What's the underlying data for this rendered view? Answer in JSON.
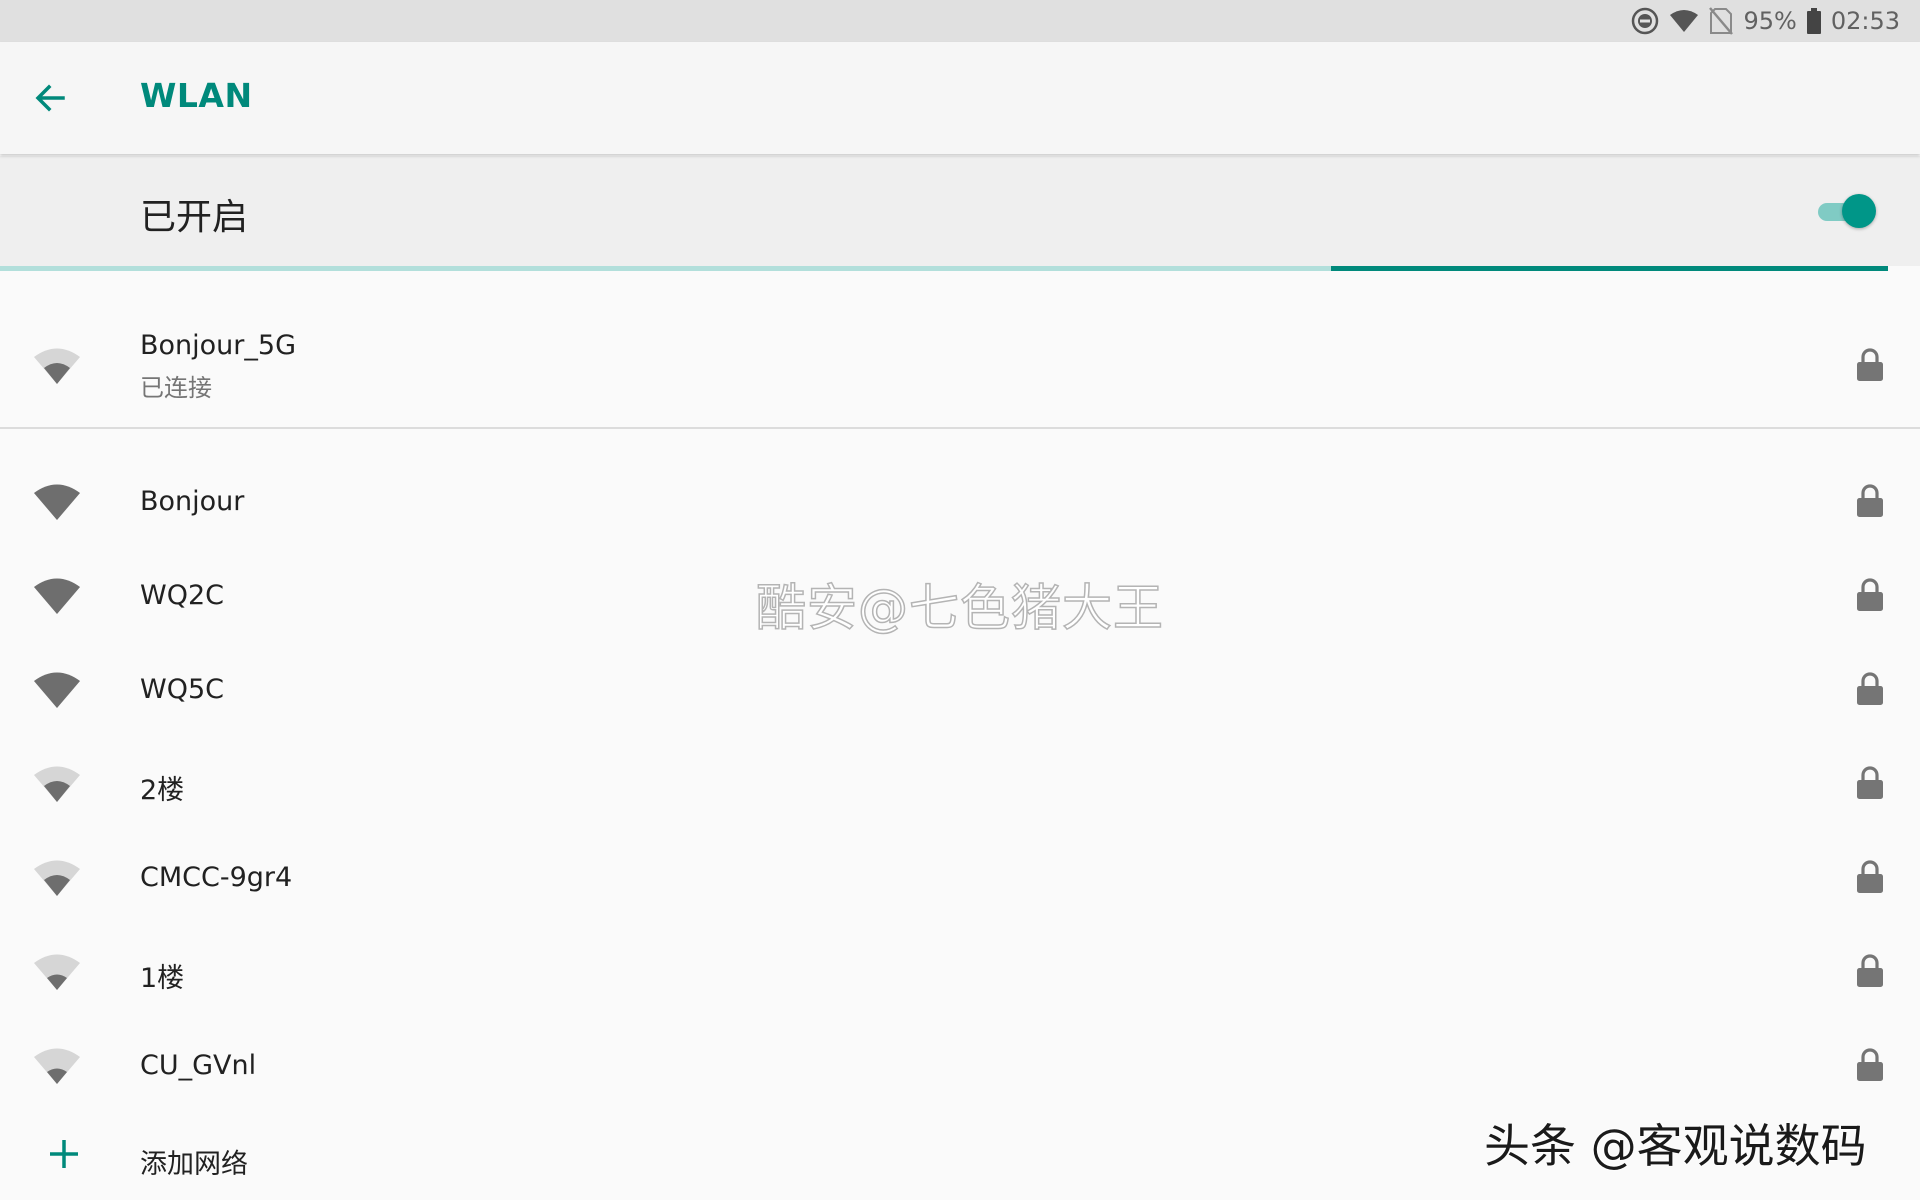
{
  "status_bar": {
    "battery_percent": "95%",
    "time": "02:53",
    "icons": [
      "do-not-disturb-icon",
      "wifi-status-icon",
      "no-sim-icon",
      "battery-icon"
    ]
  },
  "toolbar": {
    "back_icon": "arrow-left-icon",
    "title": "WLAN"
  },
  "wifi_switch": {
    "label": "已开启",
    "on": true
  },
  "scan_progress": {
    "fill_start": 0.705,
    "fill_end": 1.0
  },
  "connected_network": {
    "name": "Bonjour_5G",
    "status": "已连接",
    "signal_bars": 2,
    "secured": true
  },
  "networks": [
    {
      "name": "Bonjour",
      "signal_bars": 4,
      "secured": true
    },
    {
      "name": "WQ2C",
      "signal_bars": 4,
      "secured": true
    },
    {
      "name": "WQ5C",
      "signal_bars": 4,
      "secured": true
    },
    {
      "name": "2楼",
      "signal_bars": 2,
      "secured": true
    },
    {
      "name": "CMCC-9gr4",
      "signal_bars": 2,
      "secured": true
    },
    {
      "name": "1楼",
      "signal_bars": 1,
      "secured": true
    },
    {
      "name": "CU_GVnl",
      "signal_bars": 1,
      "secured": true
    }
  ],
  "add_network": {
    "icon": "plus-icon",
    "label": "添加网络"
  },
  "watermarks": {
    "center": "酷安@七色猪大王",
    "corner": "头条 @客观说数码"
  },
  "colors": {
    "accent": "#00897b",
    "switch_track": "#80cbc4",
    "progress_track": "#b2dfdb",
    "icon_gray": "#757575"
  }
}
